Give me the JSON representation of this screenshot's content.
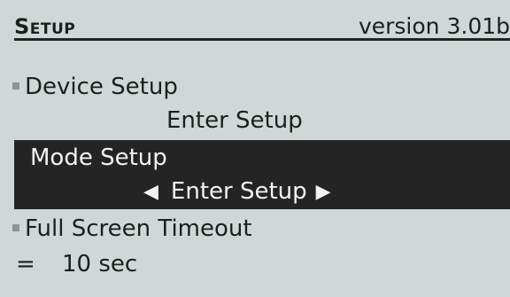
{
  "header": {
    "title": "Setup",
    "version": "version 3.01b"
  },
  "menu": {
    "device_setup": {
      "label": "Device Setup",
      "action": "Enter Setup"
    },
    "mode_setup": {
      "label": "Mode Setup",
      "action": "Enter Setup",
      "arrow_left": "◀",
      "arrow_right": "▶"
    },
    "full_screen_timeout": {
      "label": "Full Screen Timeout",
      "operator": "=",
      "value": "10 sec"
    }
  },
  "icons": {
    "bullet": "small-square-bullet",
    "left_arrow": "left-arrow-icon",
    "right_arrow": "right-arrow-icon"
  }
}
